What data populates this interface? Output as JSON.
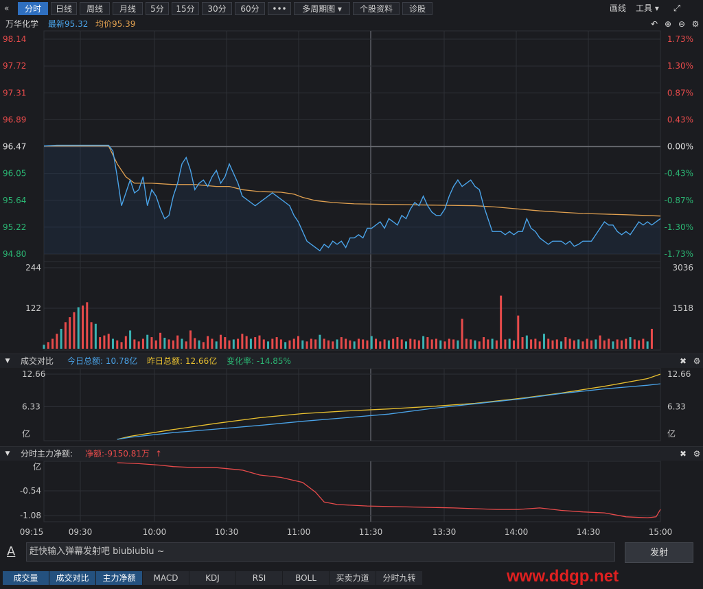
{
  "toolbar": {
    "collapse_icon": "double-chevron-left-icon",
    "tabs": [
      "分时",
      "日线",
      "周线",
      "月线",
      "5分",
      "15分",
      "30分",
      "60分",
      "•••",
      "多周期图 ▾",
      "个股资料",
      "诊股"
    ],
    "active_tab": "分时",
    "draw_label": "画线",
    "tools_label": "工具 ▾",
    "fullscreen_icon": "fullscreen-icon"
  },
  "info": {
    "stock_name": "万华化学",
    "latest": "最新95.32",
    "avg": "均价95.39"
  },
  "colors": {
    "price": "#4aa3e8",
    "avg": "#e0a050",
    "up": "#e84b4b",
    "down": "#2bb673",
    "vol_yesterday": "#e8c030",
    "bg": "#1b1c20"
  },
  "chart_data": [
    {
      "type": "line",
      "name": "price-panel",
      "y_left_ticks": [
        "98.14",
        "97.72",
        "97.31",
        "96.89",
        "96.47",
        "96.05",
        "95.64",
        "95.22",
        "94.80"
      ],
      "y_right_ticks": [
        "1.73%",
        "1.30%",
        "0.87%",
        "0.43%",
        "0.00%",
        "-0.43%",
        "-0.87%",
        "-1.30%",
        "-1.73%"
      ],
      "ylim": [
        94.8,
        98.14
      ],
      "prev_close": 96.47,
      "x_ticks": [
        "09:15",
        "09:30",
        "10:00",
        "10:30",
        "11:00",
        "11:30",
        "13:30",
        "14:00",
        "14:30",
        "15:00"
      ],
      "series": [
        {
          "name": "最新",
          "points": [
            [
              0,
              96.48
            ],
            [
              3,
              96.49
            ],
            [
              10,
              96.49
            ],
            [
              15,
              96.49
            ],
            [
              16,
              96.4
            ],
            [
              17,
              96.0
            ],
            [
              18,
              95.55
            ],
            [
              19,
              95.75
            ],
            [
              20,
              95.95
            ],
            [
              21,
              95.75
            ],
            [
              22,
              95.8
            ],
            [
              23,
              96.0
            ],
            [
              24,
              95.55
            ],
            [
              25,
              95.8
            ],
            [
              26,
              95.7
            ],
            [
              27,
              95.5
            ],
            [
              28,
              95.35
            ],
            [
              29,
              95.4
            ],
            [
              30,
              95.7
            ],
            [
              31,
              95.9
            ],
            [
              32,
              96.2
            ],
            [
              33,
              96.3
            ],
            [
              34,
              96.1
            ],
            [
              35,
              95.8
            ],
            [
              36,
              95.9
            ],
            [
              37,
              95.95
            ],
            [
              38,
              95.85
            ],
            [
              39,
              96.0
            ],
            [
              40,
              96.1
            ],
            [
              41,
              95.9
            ],
            [
              42,
              96.0
            ],
            [
              43,
              96.2
            ],
            [
              44,
              96.05
            ],
            [
              45,
              95.9
            ],
            [
              46,
              95.7
            ],
            [
              47,
              95.65
            ],
            [
              48,
              95.6
            ],
            [
              49,
              95.55
            ],
            [
              50,
              95.6
            ],
            [
              51,
              95.65
            ],
            [
              52,
              95.7
            ],
            [
              53,
              95.75
            ],
            [
              54,
              95.7
            ],
            [
              55,
              95.65
            ],
            [
              56,
              95.6
            ],
            [
              57,
              95.55
            ],
            [
              58,
              95.4
            ],
            [
              59,
              95.3
            ],
            [
              60,
              95.15
            ],
            [
              61,
              95.0
            ],
            [
              62,
              94.95
            ],
            [
              63,
              94.9
            ],
            [
              64,
              94.85
            ],
            [
              65,
              94.95
            ],
            [
              66,
              94.9
            ],
            [
              67,
              95.0
            ],
            [
              68,
              94.95
            ],
            [
              69,
              95.0
            ],
            [
              70,
              94.9
            ],
            [
              71,
              95.05
            ],
            [
              72,
              95.05
            ],
            [
              73,
              95.1
            ],
            [
              74,
              95.05
            ],
            [
              75,
              95.2
            ],
            [
              76,
              95.2
            ],
            [
              77,
              95.25
            ],
            [
              78,
              95.3
            ],
            [
              79,
              95.2
            ],
            [
              80,
              95.35
            ],
            [
              81,
              95.3
            ],
            [
              82,
              95.25
            ],
            [
              83,
              95.4
            ],
            [
              84,
              95.35
            ],
            [
              85,
              95.5
            ],
            [
              86,
              95.6
            ],
            [
              87,
              95.55
            ],
            [
              88,
              95.7
            ],
            [
              89,
              95.55
            ],
            [
              90,
              95.45
            ],
            [
              91,
              95.4
            ],
            [
              92,
              95.4
            ],
            [
              93,
              95.5
            ],
            [
              94,
              95.7
            ],
            [
              95,
              95.85
            ],
            [
              96,
              95.95
            ],
            [
              97,
              95.85
            ],
            [
              98,
              95.9
            ],
            [
              99,
              95.95
            ],
            [
              100,
              95.85
            ],
            [
              101,
              95.8
            ],
            [
              102,
              95.55
            ],
            [
              103,
              95.35
            ],
            [
              104,
              95.15
            ],
            [
              105,
              95.15
            ],
            [
              106,
              95.15
            ],
            [
              107,
              95.1
            ],
            [
              108,
              95.15
            ],
            [
              109,
              95.1
            ],
            [
              110,
              95.15
            ],
            [
              111,
              95.15
            ],
            [
              112,
              95.35
            ],
            [
              113,
              95.2
            ],
            [
              114,
              95.15
            ],
            [
              115,
              95.05
            ],
            [
              116,
              95.0
            ],
            [
              117,
              94.95
            ],
            [
              118,
              95.0
            ],
            [
              119,
              95.0
            ],
            [
              120,
              95.0
            ],
            [
              121,
              94.95
            ],
            [
              122,
              95.0
            ],
            [
              123,
              94.92
            ],
            [
              124,
              94.95
            ],
            [
              125,
              95.0
            ],
            [
              126,
              95.0
            ],
            [
              127,
              95.0
            ],
            [
              128,
              95.1
            ],
            [
              129,
              95.2
            ],
            [
              130,
              95.3
            ],
            [
              131,
              95.25
            ],
            [
              132,
              95.25
            ],
            [
              133,
              95.15
            ],
            [
              134,
              95.1
            ],
            [
              135,
              95.15
            ],
            [
              136,
              95.1
            ],
            [
              137,
              95.2
            ],
            [
              138,
              95.3
            ],
            [
              139,
              95.25
            ],
            [
              140,
              95.3
            ],
            [
              141,
              95.25
            ],
            [
              142,
              95.3
            ],
            [
              143,
              95.35
            ]
          ]
        },
        {
          "name": "均价",
          "points": [
            [
              0,
              96.48
            ],
            [
              15,
              96.48
            ],
            [
              17,
              96.2
            ],
            [
              19,
              96.0
            ],
            [
              21,
              95.9
            ],
            [
              25,
              95.9
            ],
            [
              30,
              95.88
            ],
            [
              35,
              95.88
            ],
            [
              40,
              95.85
            ],
            [
              43,
              95.85
            ],
            [
              46,
              95.8
            ],
            [
              50,
              95.77
            ],
            [
              55,
              95.76
            ],
            [
              58,
              95.73
            ],
            [
              60,
              95.68
            ],
            [
              63,
              95.63
            ],
            [
              67,
              95.6
            ],
            [
              72,
              95.58
            ],
            [
              80,
              95.57
            ],
            [
              90,
              95.56
            ],
            [
              100,
              95.55
            ],
            [
              105,
              95.53
            ],
            [
              110,
              95.5
            ],
            [
              115,
              95.47
            ],
            [
              120,
              95.45
            ],
            [
              125,
              95.43
            ],
            [
              130,
              95.42
            ],
            [
              135,
              95.41
            ],
            [
              143,
              95.39
            ]
          ]
        }
      ]
    },
    {
      "type": "bar",
      "name": "volume-panel",
      "y_left_ticks": [
        "244",
        "122"
      ],
      "y_right_ticks": [
        "3036",
        "1518"
      ],
      "ylim": [
        0,
        244
      ],
      "values": [
        12,
        20,
        30,
        45,
        60,
        80,
        95,
        110,
        125,
        130,
        140,
        80,
        75,
        35,
        40,
        45,
        30,
        25,
        20,
        38,
        55,
        28,
        22,
        30,
        42,
        35,
        25,
        48,
        33,
        28,
        25,
        40,
        30,
        22,
        55,
        32,
        25,
        20,
        38,
        30,
        22,
        42,
        35,
        25,
        28,
        30,
        45,
        38,
        30,
        35,
        40,
        28,
        22,
        30,
        35,
        28,
        20,
        25,
        30,
        38,
        25,
        22,
        30,
        28,
        42,
        30,
        25,
        22,
        28,
        35,
        30,
        25,
        22,
        30,
        28,
        25,
        38,
        30,
        22,
        28,
        25,
        30,
        35,
        28,
        22,
        30,
        28,
        25,
        38,
        35,
        28,
        30,
        25,
        22,
        30,
        28,
        25,
        90,
        30,
        28,
        25,
        22,
        35,
        28,
        30,
        25,
        160,
        28,
        30,
        25,
        100,
        35,
        40,
        28,
        30,
        22,
        45,
        30,
        25,
        28,
        22,
        35,
        30,
        25,
        28,
        22,
        30,
        25,
        28,
        40,
        25,
        30,
        22,
        28,
        25,
        30,
        35,
        28,
        25,
        30,
        22,
        60
      ]
    },
    {
      "type": "line",
      "name": "turnover-compare",
      "y_left_ticks": [
        "12.66",
        "6.33",
        "亿"
      ],
      "y_right_ticks": [
        "12.66",
        "6.33",
        "亿"
      ],
      "ylim": [
        0,
        12.66
      ],
      "series": [
        {
          "name": "昨日总额",
          "points": [
            [
              17,
              0
            ],
            [
              20,
              0.6
            ],
            [
              30,
              1.9
            ],
            [
              40,
              3.1
            ],
            [
              50,
              4.2
            ],
            [
              60,
              5.0
            ],
            [
              70,
              5.5
            ],
            [
              80,
              5.9
            ],
            [
              90,
              6.4
            ],
            [
              100,
              7.0
            ],
            [
              110,
              7.9
            ],
            [
              120,
              9.0
            ],
            [
              130,
              10.3
            ],
            [
              140,
              11.8
            ],
            [
              143,
              12.66
            ]
          ]
        },
        {
          "name": "今日总额",
          "points": [
            [
              17,
              0
            ],
            [
              20,
              0.4
            ],
            [
              30,
              1.3
            ],
            [
              40,
              2.0
            ],
            [
              50,
              2.7
            ],
            [
              60,
              3.5
            ],
            [
              70,
              4.2
            ],
            [
              80,
              4.9
            ],
            [
              90,
              6.0
            ],
            [
              100,
              6.9
            ],
            [
              110,
              7.8
            ],
            [
              120,
              8.9
            ],
            [
              130,
              9.8
            ],
            [
              140,
              10.5
            ],
            [
              143,
              10.78
            ]
          ]
        }
      ]
    },
    {
      "type": "line",
      "name": "main-capital",
      "y_left_ticks": [
        "亿",
        "-0.54",
        "-1.08"
      ],
      "ylim": [
        -1.2,
        0
      ],
      "series": [
        {
          "name": "净额",
          "points": [
            [
              17,
              0
            ],
            [
              22,
              -0.02
            ],
            [
              27,
              -0.05
            ],
            [
              30,
              -0.08
            ],
            [
              35,
              -0.1
            ],
            [
              40,
              -0.1
            ],
            [
              46,
              -0.15
            ],
            [
              50,
              -0.25
            ],
            [
              55,
              -0.3
            ],
            [
              60,
              -0.4
            ],
            [
              63,
              -0.6
            ],
            [
              65,
              -0.8
            ],
            [
              68,
              -0.85
            ],
            [
              75,
              -0.88
            ],
            [
              85,
              -0.9
            ],
            [
              95,
              -0.92
            ],
            [
              105,
              -0.95
            ],
            [
              110,
              -0.95
            ],
            [
              115,
              -0.92
            ],
            [
              120,
              -0.97
            ],
            [
              125,
              -1.0
            ],
            [
              130,
              -1.02
            ],
            [
              135,
              -1.1
            ],
            [
              140,
              -1.12
            ],
            [
              142,
              -1.1
            ],
            [
              143,
              -0.95
            ]
          ]
        }
      ]
    }
  ],
  "compare": {
    "section_title": "成交对比",
    "today": "今日总额: 10.78亿",
    "yesterday": "昨日总额: 12.66亿",
    "change": "变化率: -14.85%"
  },
  "capital": {
    "section_title": "分时主力净额:",
    "net": "净额:-9150.81万"
  },
  "danmaku": {
    "icon": "font-a-icon",
    "placeholder": "赶快输入弹幕发射吧 biubiubiu ~",
    "send_label": "发射"
  },
  "bottom_tabs": [
    "成交量",
    "成交对比",
    "主力净额",
    "MACD",
    "KDJ",
    "RSI",
    "BOLL",
    "买卖力道",
    "分时九转"
  ],
  "bottom_active": [
    "成交量",
    "成交对比",
    "主力净额"
  ],
  "watermark": "www.ddgp.net"
}
